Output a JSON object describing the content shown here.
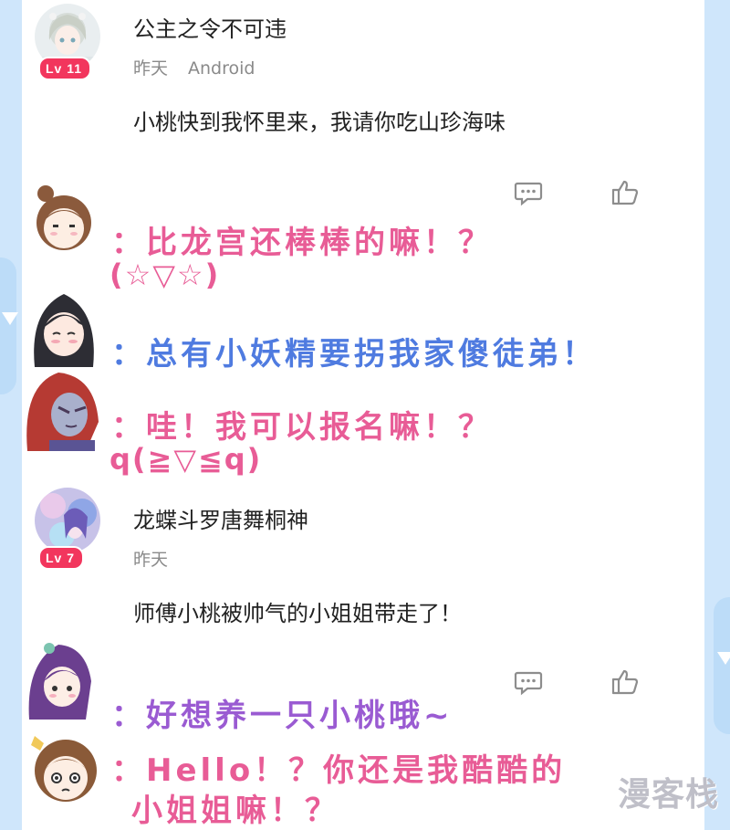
{
  "comments": [
    {
      "username": "公主之令不可违",
      "level": "Lv 11",
      "time": "昨天",
      "device": "Android",
      "content": "小桃快到我怀里来，我请你吃山珍海味"
    },
    {
      "username": "龙蝶斗罗唐舞桐神",
      "level": "Lv 7",
      "time": "昨天",
      "device": "",
      "content": "师傅小桃被帅气的小姐姐带走了！"
    }
  ],
  "reactions": [
    {
      "line1": "：比龙宫还棒棒的嘛！？",
      "line2": "(☆▽☆)",
      "color": "#e85c96"
    },
    {
      "line1": "：总有小妖精要拐我家傻徒弟！",
      "line2": "",
      "color": "#4f7be0"
    },
    {
      "line1": "：哇！我可以报名嘛！？",
      "line2": "q(≧▽≦q)",
      "color": "#e85c96"
    },
    {
      "line1": "：好想养一只小桃哦~",
      "line2": "",
      "color": "#9a5bd2"
    },
    {
      "line1": "：Hello！？你还是我酷酷的",
      "line2": "小姐姐嘛！？",
      "color": "#e85c96"
    }
  ],
  "icons": {
    "comment": "comment-bubble-icon",
    "like": "thumbs-up-icon"
  },
  "watermark": "漫客栈",
  "colors": {
    "side_border": "#cfe6fb",
    "level_badge": "#f2365d"
  }
}
